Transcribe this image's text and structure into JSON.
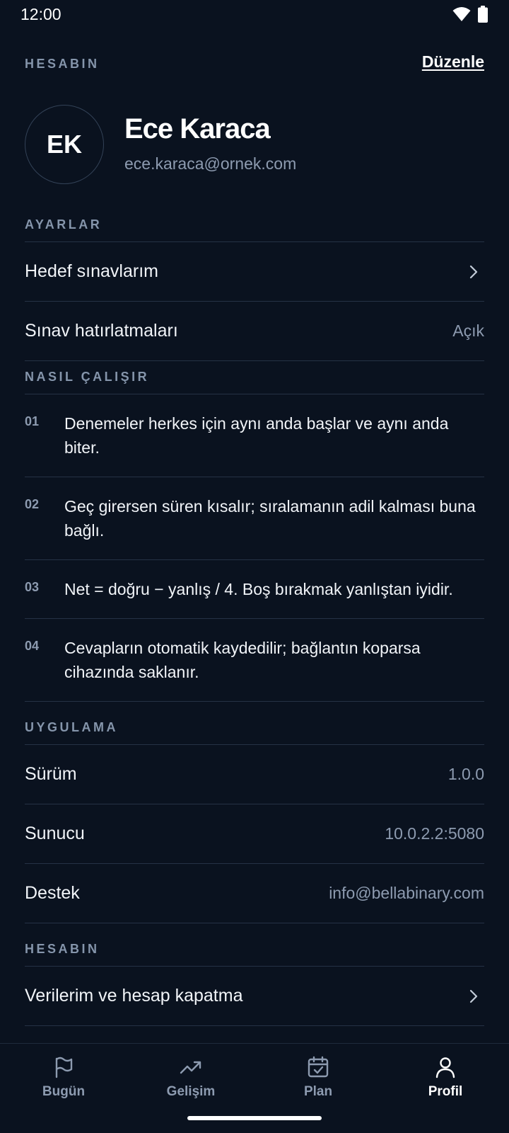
{
  "status_bar": {
    "time": "12:00"
  },
  "header": {
    "section_label": "HESABIN",
    "edit_label": "Düzenle"
  },
  "profile": {
    "initials": "EK",
    "name": "Ece Karaca",
    "email": "ece.karaca@ornek.com"
  },
  "settings": {
    "label": "AYARLAR",
    "items": [
      {
        "label": "Hedef sınavlarım",
        "value": ""
      },
      {
        "label": "Sınav hatırlatmaları",
        "value": "Açık"
      }
    ]
  },
  "how_it_works": {
    "label": "NASIL ÇALIŞIR",
    "steps": [
      {
        "num": "01",
        "text": "Denemeler herkes için aynı anda başlar ve aynı anda biter."
      },
      {
        "num": "02",
        "text": "Geç girersen süren kısalır; sıralamanın adil kalması buna bağlı."
      },
      {
        "num": "03",
        "text": "Net = doğru − yanlış / 4. Boş bırakmak yanlıştan iyidir."
      },
      {
        "num": "04",
        "text": "Cevapların otomatik kaydedilir; bağlantın koparsa cihazında saklanır."
      }
    ]
  },
  "app": {
    "label": "UYGULAMA",
    "items": [
      {
        "label": "Sürüm",
        "value": "1.0.0"
      },
      {
        "label": "Sunucu",
        "value": "10.0.2.2:5080"
      },
      {
        "label": "Destek",
        "value": "info@bellabinary.com"
      }
    ]
  },
  "account": {
    "label": "HESABIN",
    "items": [
      {
        "label": "Verilerim ve hesap kapatma"
      }
    ]
  },
  "bottom_nav": {
    "items": [
      {
        "label": "Bugün",
        "icon": "flag-icon"
      },
      {
        "label": "Gelişim",
        "icon": "trending-up-icon"
      },
      {
        "label": "Plan",
        "icon": "calendar-check-icon"
      },
      {
        "label": "Profil",
        "icon": "user-icon",
        "active": true
      }
    ]
  },
  "colors": {
    "background": "#0a121f",
    "muted": "#8d9bb0",
    "divider": "#253245",
    "text": "#f1f4f8"
  }
}
